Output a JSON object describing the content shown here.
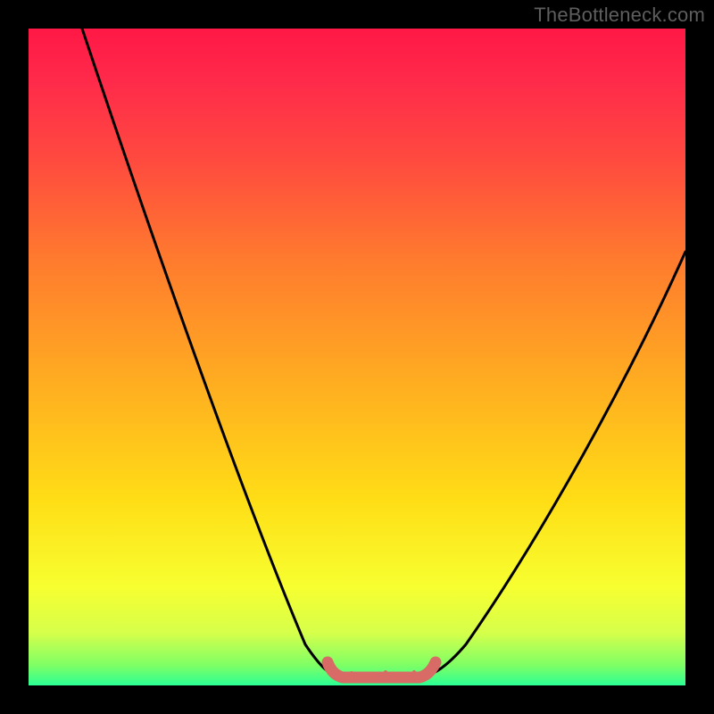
{
  "watermark": {
    "text": "TheBottleneck.com"
  },
  "colors": {
    "background": "#000000",
    "curve": "#000000",
    "marker": "#d96b66",
    "gradient_stops": [
      "#ff1846",
      "#ff2a4a",
      "#ff4a3f",
      "#ff7a2e",
      "#ffb020",
      "#ffde16",
      "#f7ff30",
      "#d6ff4a",
      "#7dff66",
      "#2aff94"
    ]
  },
  "chart_data": {
    "type": "line",
    "title": "",
    "xlabel": "",
    "ylabel": "",
    "xlim": [
      0,
      100
    ],
    "ylim": [
      0,
      100
    ],
    "grid": false,
    "legend": false,
    "left_branch": [
      {
        "x": 8,
        "y": 100
      },
      {
        "x": 13,
        "y": 90
      },
      {
        "x": 18,
        "y": 79
      },
      {
        "x": 23,
        "y": 67
      },
      {
        "x": 28,
        "y": 54
      },
      {
        "x": 33,
        "y": 40
      },
      {
        "x": 38,
        "y": 26
      },
      {
        "x": 42,
        "y": 14
      },
      {
        "x": 45,
        "y": 6
      },
      {
        "x": 47,
        "y": 2
      }
    ],
    "right_branch": [
      {
        "x": 60,
        "y": 2
      },
      {
        "x": 63,
        "y": 5
      },
      {
        "x": 67,
        "y": 11
      },
      {
        "x": 72,
        "y": 20
      },
      {
        "x": 78,
        "y": 31
      },
      {
        "x": 85,
        "y": 43
      },
      {
        "x": 92,
        "y": 55
      },
      {
        "x": 100,
        "y": 66
      }
    ],
    "sweet_spot_baseline_y": 2,
    "sweet_spot_markers": [
      {
        "x": 47,
        "y": 2
      },
      {
        "x": 50,
        "y": 1
      },
      {
        "x": 53,
        "y": 1
      },
      {
        "x": 56,
        "y": 1
      },
      {
        "x": 60,
        "y": 2
      }
    ]
  }
}
